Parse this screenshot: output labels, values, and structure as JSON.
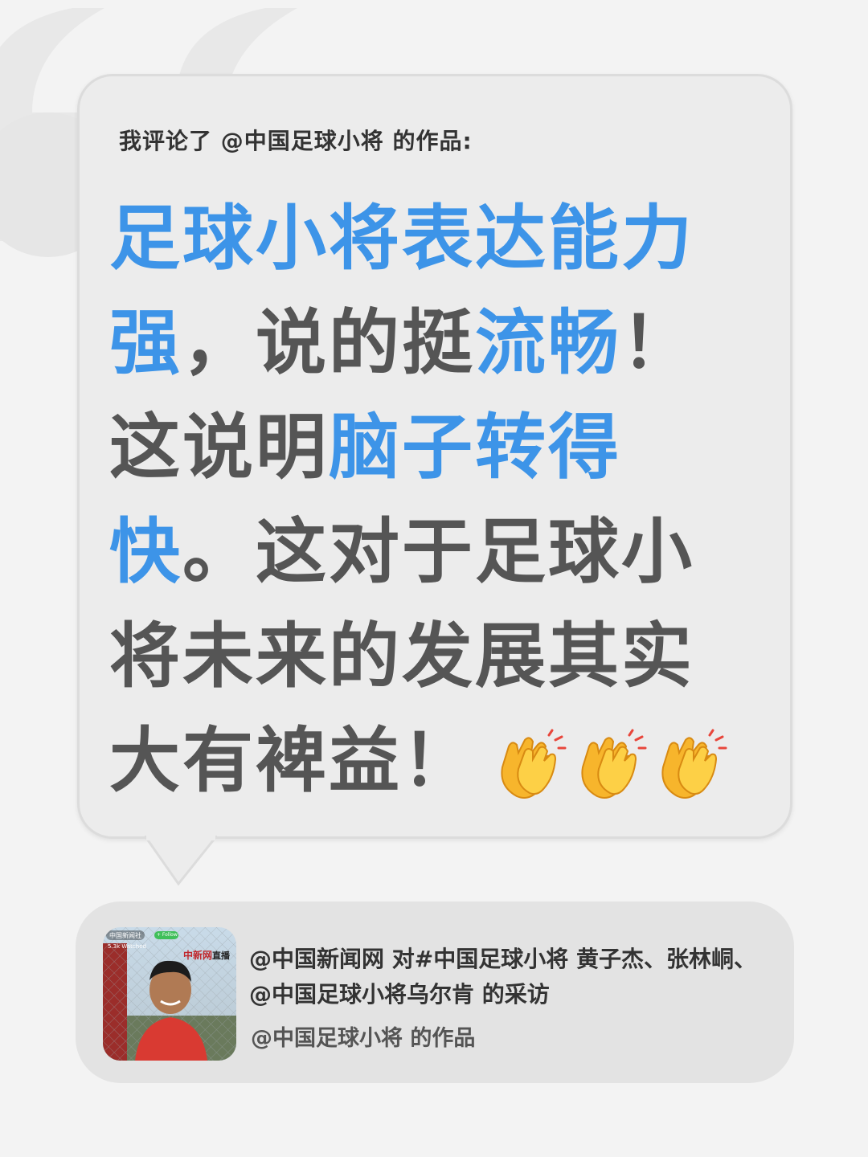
{
  "comment": {
    "header": "我评论了 @中国足球小将 的作品:",
    "lines": [
      [
        {
          "text": "足球小将表达能力",
          "highlight": true
        }
      ],
      [
        {
          "text": "强",
          "highlight": true
        },
        {
          "text": "，说的挺",
          "highlight": false
        },
        {
          "text": "流畅",
          "highlight": true
        },
        {
          "text": "！",
          "highlight": false
        }
      ],
      [
        {
          "text": "这说明",
          "highlight": false
        },
        {
          "text": "脑子转得",
          "highlight": true
        }
      ],
      [
        {
          "text": "快",
          "highlight": true
        },
        {
          "text": "。这对于足球小",
          "highlight": false
        }
      ],
      [
        {
          "text": "将未来的发展其实",
          "highlight": false
        }
      ],
      [
        {
          "text": "大有裨益！",
          "highlight": false
        }
      ]
    ],
    "emoji_icons": [
      "clapping-hands-icon",
      "clapping-hands-icon",
      "clapping-hands-icon"
    ]
  },
  "reference": {
    "title": "@中国新闻网 对#中国足球小将 黄子杰、张林峒、@中国足球小将乌尔肯 的采访",
    "author": "@中国足球小将 的作品",
    "thumbnail": {
      "overlay_source": "中国新闻社",
      "overlay_follow": "+ Follow",
      "overlay_viewers": "5.3k Watched",
      "overlay_logo": "中新网",
      "overlay_live": "直播"
    }
  },
  "colors": {
    "highlight": "#3d94e8",
    "text": "#555555",
    "background": "#f3f3f3",
    "bubble": "#ececec",
    "card": "#e3e3e3"
  }
}
